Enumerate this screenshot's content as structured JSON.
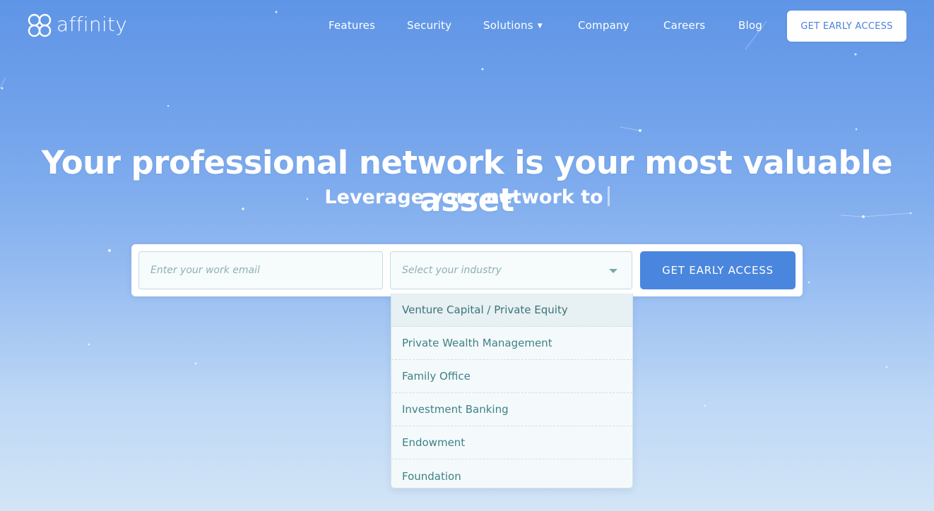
{
  "brand": {
    "name": "affinity"
  },
  "nav": {
    "links": [
      {
        "label": "Features",
        "icon": null
      },
      {
        "label": "Security",
        "icon": null
      },
      {
        "label": "Solutions",
        "icon": "caret-down-icon"
      },
      {
        "label": "Company",
        "icon": null
      },
      {
        "label": "Careers",
        "icon": null
      },
      {
        "label": "Blog",
        "icon": null
      }
    ],
    "cta_label": "GET EARLY ACCESS"
  },
  "hero": {
    "headline": "Your professional network is your most valuable asset",
    "subline": "Leverage your network to"
  },
  "signup": {
    "email_placeholder": "Enter your work email",
    "industry_placeholder": "Select your industry",
    "cta_label": "GET EARLY ACCESS",
    "industry_options": [
      "Venture Capital / Private Equity",
      "Private Wealth Management",
      "Family Office",
      "Investment Banking",
      "Endowment",
      "Foundation"
    ]
  },
  "colors": {
    "background_top": "#5f95e6",
    "background_bottom": "#d3e5f6",
    "primary_button": "#4a86dd",
    "dropdown_text": "#3f8086"
  }
}
